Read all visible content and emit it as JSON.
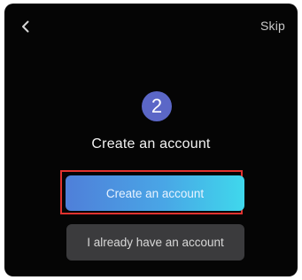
{
  "header": {
    "back_icon": "chevron-left-icon",
    "skip_label": "Skip"
  },
  "step": {
    "number": "2",
    "title": "Create an account"
  },
  "actions": {
    "primary_label": "Create an account",
    "secondary_label": "I already have an account"
  },
  "colors": {
    "background": "#050505",
    "badge": "#5b67c7",
    "primary_gradient_start": "#4f7fd9",
    "primary_gradient_end": "#3fd8ec",
    "secondary_button": "#3b3b3d",
    "highlight": "#e0322f"
  }
}
